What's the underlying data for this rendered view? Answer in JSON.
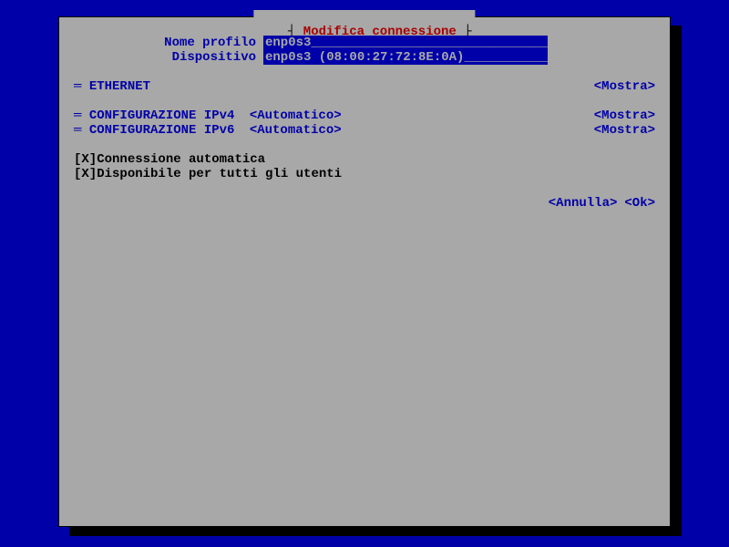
{
  "dialog": {
    "title_left": "┤ ",
    "title_mid": "Modifica connessione",
    "title_right": " ├"
  },
  "form": {
    "profile_label": "Nome profilo",
    "profile_value": "enp0s3_",
    "profile_pad": "________________________________",
    "device_label": "Dispositivo",
    "device_value": "enp0s3 (08:00:27:72:8E:0A)",
    "device_pad": "_____________"
  },
  "sections": {
    "eth_prefix": "═ ",
    "eth_label": "ETHERNET",
    "ipv4_label": "CONFIGURAZIONE IPv4",
    "ipv6_label": "CONFIGURAZIONE IPv6",
    "auto_value": "<Automatico>",
    "show_label": "<Mostra>"
  },
  "checks": {
    "autoconn_box": "[X]",
    "autoconn_label": " Connessione automatica",
    "allusers_box": "[X]",
    "allusers_label": " Disponibile per tutti gli utenti"
  },
  "buttons": {
    "cancel": "<Annulla>",
    "ok": "<Ok>"
  }
}
